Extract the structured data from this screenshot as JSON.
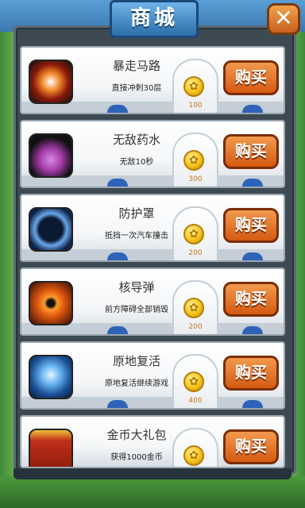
{
  "title": "商城",
  "close_icon": "close-x-icon",
  "buy_label": "购买",
  "currency_icon": "gold-coin-icon",
  "items": [
    {
      "name": "暴走马路",
      "desc": "直接冲刺30层",
      "price": "100",
      "icon": "dash-boot-icon",
      "accent": "#c0301a"
    },
    {
      "name": "无敌药水",
      "desc": "无敌10秒",
      "price": "300",
      "icon": "potion-icon",
      "accent": "#a23aa8"
    },
    {
      "name": "防护罩",
      "desc": "抵挡一次汽车撞击",
      "price": "200",
      "icon": "shield-bubble-icon",
      "accent": "#2a5fa5"
    },
    {
      "name": "核导弹",
      "desc": "前方障碍全部销毁",
      "price": "200",
      "icon": "nuke-icon",
      "accent": "#e05a10"
    },
    {
      "name": "原地复活",
      "desc": "原地复活继续游戏",
      "price": "400",
      "icon": "revive-icon",
      "accent": "#3a8fe0"
    },
    {
      "name": "金币大礼包",
      "desc": "获得1000金币",
      "price": "",
      "icon": "gift-box-icon",
      "accent": "#c0301a"
    }
  ]
}
